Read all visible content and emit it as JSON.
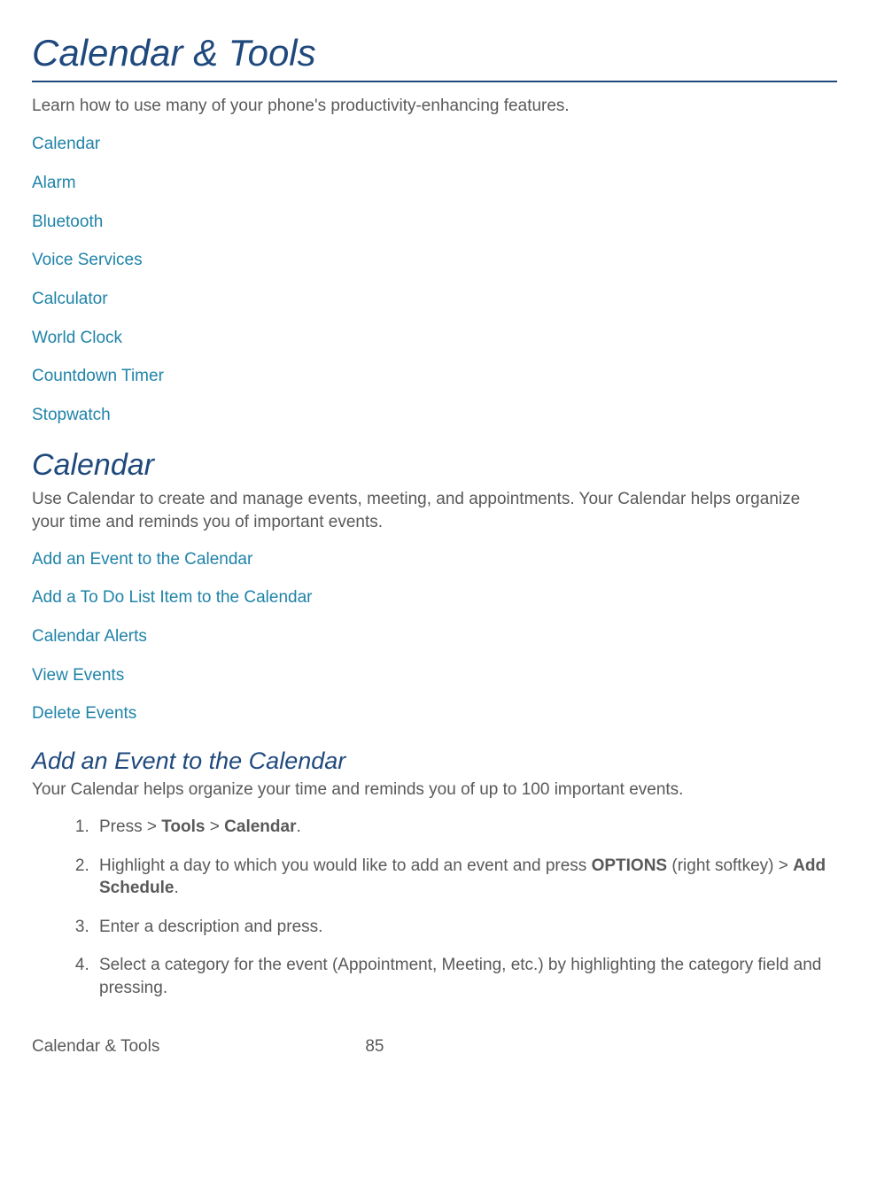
{
  "page": {
    "title": "Calendar & Tools",
    "intro": "Learn how to use many of your phone's productivity-enhancing features.",
    "links": [
      "Calendar",
      "Alarm",
      "Bluetooth",
      "Voice Services",
      "Calculator",
      "World Clock",
      "Countdown Timer",
      "Stopwatch"
    ]
  },
  "calendar_section": {
    "heading": "Calendar",
    "intro": "Use Calendar to create and manage events, meeting, and appointments. Your Calendar helps organize your time and reminds you of important events.",
    "links": [
      "Add an Event to the Calendar",
      "Add a To Do List Item to the Calendar",
      "Calendar Alerts",
      "View Events",
      "Delete Events"
    ]
  },
  "add_event_section": {
    "heading": "Add an Event to the Calendar",
    "intro": "Your Calendar helps organize your time and reminds you of up to 100 important events.",
    "steps": {
      "s1_a": "Press  > ",
      "s1_b": "Tools",
      "s1_c": " > ",
      "s1_d": "Calendar",
      "s1_e": ".",
      "s2_a": "Highlight a day to which you would like to add an event and press ",
      "s2_b": "OPTIONS",
      "s2_c": " (right softkey) > ",
      "s2_d": "Add Schedule",
      "s2_e": ".",
      "s3": "Enter a description and press.",
      "s4": "Select a category for the event (Appointment, Meeting, etc.) by highlighting the category field and pressing."
    }
  },
  "footer": {
    "title": "Calendar & Tools",
    "page_number": "85"
  }
}
